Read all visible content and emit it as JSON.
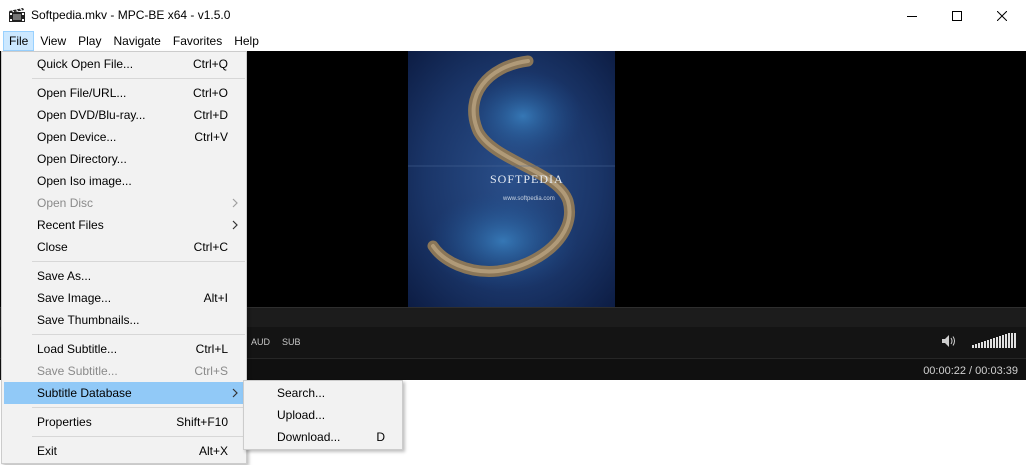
{
  "window": {
    "title": "Softpedia.mkv - MPC-BE x64 - v1.5.0"
  },
  "menubar": {
    "items": [
      {
        "label": "File"
      },
      {
        "label": "View"
      },
      {
        "label": "Play"
      },
      {
        "label": "Navigate"
      },
      {
        "label": "Favorites"
      },
      {
        "label": "Help"
      }
    ]
  },
  "file_menu": {
    "items": [
      {
        "label": "Quick Open File...",
        "shortcut": "Ctrl+Q"
      },
      {
        "label": "Open File/URL...",
        "shortcut": "Ctrl+O"
      },
      {
        "label": "Open DVD/Blu-ray...",
        "shortcut": "Ctrl+D"
      },
      {
        "label": "Open Device...",
        "shortcut": "Ctrl+V"
      },
      {
        "label": "Open Directory...",
        "shortcut": ""
      },
      {
        "label": "Open Iso image...",
        "shortcut": ""
      },
      {
        "label": "Open Disc",
        "shortcut": ""
      },
      {
        "label": "Recent Files",
        "shortcut": ""
      },
      {
        "label": "Close",
        "shortcut": "Ctrl+C"
      },
      {
        "label": "Save As...",
        "shortcut": ""
      },
      {
        "label": "Save Image...",
        "shortcut": "Alt+I"
      },
      {
        "label": "Save Thumbnails...",
        "shortcut": ""
      },
      {
        "label": "Load Subtitle...",
        "shortcut": "Ctrl+L"
      },
      {
        "label": "Save Subtitle...",
        "shortcut": "Ctrl+S"
      },
      {
        "label": "Subtitle Database",
        "shortcut": ""
      },
      {
        "label": "Properties",
        "shortcut": "Shift+F10"
      },
      {
        "label": "Exit",
        "shortcut": "Alt+X"
      }
    ]
  },
  "subtitle_submenu": {
    "items": [
      {
        "label": "Search...",
        "shortcut": ""
      },
      {
        "label": "Upload...",
        "shortcut": ""
      },
      {
        "label": "Download...",
        "shortcut": "D"
      }
    ]
  },
  "video": {
    "watermark_title": "SOFTPEDIA",
    "watermark_url": "www.softpedia.com"
  },
  "controls": {
    "audio_label": "AUD",
    "subtitle_label": "SUB",
    "time": "00:00:22 / 00:03:39",
    "volume_level": 1.0
  },
  "watermark": "SOFTPEDIA",
  "colors": {
    "menu_highlight": "#91c9f7",
    "menubar_active": "#cce8ff",
    "disabled_text": "#8a8a8a",
    "player_background": "#000000"
  }
}
